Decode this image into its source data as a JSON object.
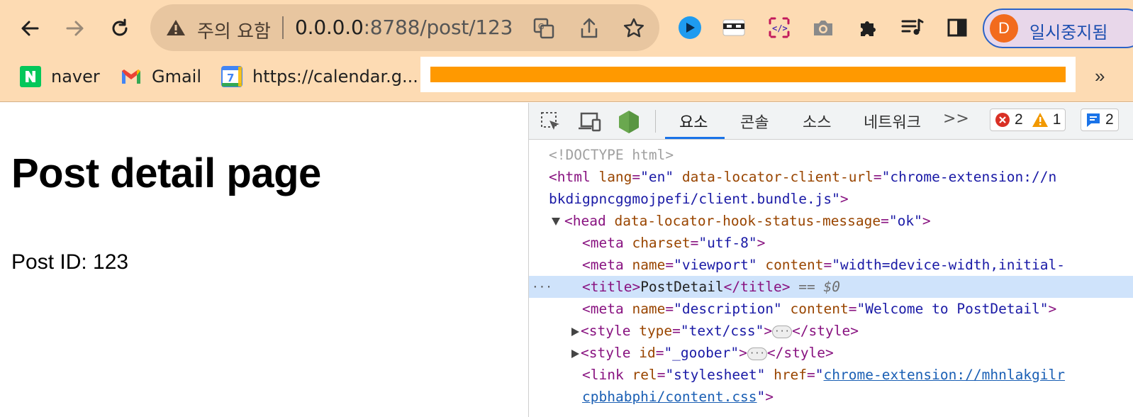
{
  "browser": {
    "security_warning": "주의 요함",
    "url_host": "0.0.0.0",
    "url_path": ":8788/post/123",
    "profile": {
      "initial": "D",
      "label": "일시중지됨"
    },
    "colors": {
      "frame": "#fddbb3",
      "omnibox": "#e8c6a0",
      "profile_border": "#2b63c7",
      "avatar": "#f26b1d"
    },
    "icons": [
      "back-arrow-icon",
      "forward-arrow-icon",
      "reload-icon",
      "warning-triangle-icon",
      "translate-icon",
      "share-icon",
      "bookmark-star-icon",
      "extension-iq-icon",
      "extension-mask-icon",
      "extension-code-icon",
      "extension-camera-icon",
      "extensions-puzzle-icon",
      "media-queue-icon",
      "side-panel-icon"
    ]
  },
  "bookmarks": {
    "items": [
      {
        "label": "naver",
        "icon": "naver-icon"
      },
      {
        "label": "Gmail",
        "icon": "gmail-icon"
      },
      {
        "label": "https://calendar.g...",
        "icon": "calendar-icon"
      }
    ],
    "more": "»",
    "highlight_color": "#ff9900"
  },
  "page": {
    "title": "Post detail page",
    "post_id": "Post ID: 123"
  },
  "devtools": {
    "tabs": [
      "요소",
      "콘솔",
      "소스",
      "네트워크"
    ],
    "more_tabs": ">>",
    "errors": "2",
    "warnings": "1",
    "messages": "2",
    "lines": [
      {
        "doctype": "<!DOCTYPE html>"
      },
      {
        "tag_open": "<html",
        "a1": "lang",
        "v1": "\"en\"",
        "a2": "data-locator-client-url",
        "v2": "\"chrome-extension://n"
      },
      {
        "cont": "bkdigpncggmojpefi/client.bundle.js\"",
        "tag_close": ">"
      },
      {
        "tag_open": "<head",
        "a1": "data-locator-hook-status-message",
        "v1": "\"ok\"",
        "tag_close": ">"
      },
      {
        "tag_open": "<meta",
        "a1": "charset",
        "v1": "\"utf-8\"",
        "tag_close": ">"
      },
      {
        "tag_open": "<meta",
        "a1": "name",
        "v1": "\"viewport\"",
        "a2": "content",
        "v2": "\"width=device-width,initial-"
      },
      {
        "tag_open": "<title>",
        "text": "PostDetail",
        "tag_close": "</title>",
        "ref": "== $0"
      },
      {
        "tag_open": "<meta",
        "a1": "name",
        "v1": "\"description\"",
        "a2": "content",
        "v2": "\"Welcome to PostDetail\"",
        "tag_close": ">"
      },
      {
        "tag_open": "<style",
        "a1": "type",
        "v1": "\"text/css\"",
        "tag_close": ">",
        "end_tag": "</style>"
      },
      {
        "tag_open": "<style",
        "a1": "id",
        "v1": "\"_goober\"",
        "tag_close": ">",
        "end_tag": "</style>"
      },
      {
        "tag_open": "<link",
        "a1": "rel",
        "v1": "\"stylesheet\"",
        "a2": "href",
        "v2_link": "chrome-extension://mhnlakgilr"
      },
      {
        "cont_link": "cpbhabphi/content.css",
        "v_end": "\"",
        "tag_close": ">"
      }
    ],
    "ellipsis": "···"
  }
}
